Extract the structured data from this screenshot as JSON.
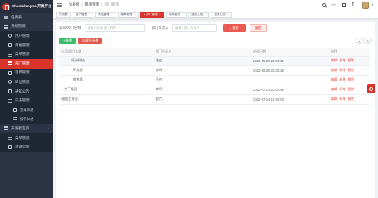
{
  "brand": {
    "name": "Chomolungma 开发平台",
    "accent": "#d9342b"
  },
  "sidebar": {
    "items": [
      {
        "label": "任务表",
        "level": 0,
        "icon": "ln",
        "name": "sidebar-item-task-table"
      },
      {
        "label": "系统管理",
        "level": 0,
        "icon": "gr",
        "name": "sidebar-item-system",
        "chev": "^"
      },
      {
        "label": "用户管理",
        "level": 1,
        "icon": "ci",
        "name": "sidebar-item-users"
      },
      {
        "label": "角色管理",
        "level": 1,
        "icon": "sq",
        "name": "sidebar-item-roles"
      },
      {
        "label": "菜单管理",
        "level": 1,
        "icon": "ln",
        "name": "sidebar-item-menus"
      },
      {
        "label": "部门管理",
        "level": 1,
        "icon": "gr",
        "name": "sidebar-item-depts",
        "active": true
      },
      {
        "label": "字典管理",
        "level": 1,
        "icon": "sq",
        "name": "sidebar-item-dict"
      },
      {
        "label": "岗位管理",
        "level": 1,
        "icon": "ci",
        "name": "sidebar-item-posts"
      },
      {
        "label": "通知公告",
        "level": 1,
        "icon": "sq",
        "name": "sidebar-item-notice"
      },
      {
        "label": "日志管理",
        "level": 1,
        "icon": "ln",
        "name": "sidebar-item-logs",
        "chev": "^"
      },
      {
        "label": "登录日志",
        "level": 2,
        "icon": "sq",
        "name": "sidebar-item-login-log"
      },
      {
        "label": "操作日志",
        "level": 2,
        "icon": "ln",
        "name": "sidebar-item-oper-log"
      },
      {
        "label": "开发者选项",
        "level": 0,
        "icon": "gr",
        "name": "sidebar-item-dev",
        "chev": "^"
      },
      {
        "label": "菜单管理",
        "level": 1,
        "icon": "ln",
        "name": "sidebar-item-dev-menus"
      },
      {
        "label": "测试页面",
        "level": 1,
        "icon": "sq",
        "name": "sidebar-item-test-page"
      }
    ]
  },
  "header": {
    "breadcrumb": [
      "仪表盘",
      "系统管理",
      "部门管理"
    ]
  },
  "tags": [
    {
      "label": "任务表"
    },
    {
      "label": "用户管理"
    },
    {
      "label": "角色管理"
    },
    {
      "label": "菜单管理"
    },
    {
      "label": "部门管理",
      "active": true
    },
    {
      "label": "字典管理"
    },
    {
      "label": "通知公告"
    },
    {
      "label": "登录日志"
    }
  ],
  "query": {
    "name_label": "公司/部门名称",
    "name_placeholder": "请输入公司/部门名称",
    "leader_label": "部门负责人",
    "leader_placeholder": "请输入部门负责人",
    "search_label": "搜索",
    "reset_label": "重置"
  },
  "actions": {
    "add_label": "+ 新增",
    "expand_label": "⇅ 展开/折叠"
  },
  "table": {
    "columns": [
      "公司/部门名称",
      "部门负责人",
      "创建日期",
      "操作"
    ],
    "rows": [
      {
        "name": "阿诚科技",
        "leader": "张三",
        "date": "2022-05-25 22:30:01",
        "indent": 1,
        "expander": "⌄",
        "hl": true
      },
      {
        "name": "开发部",
        "leader": "李四",
        "date": "2022-05-25 22:35:26",
        "indent": 2
      },
      {
        "name": "销售部",
        "leader": "王五",
        "date": "",
        "indent": 2
      },
      {
        "name": "大干集团",
        "leader": "李四",
        "date": "2022-07-13 22:00:48",
        "indent": 0,
        "expander": "›"
      },
      {
        "name": "雅居工作室",
        "leader": "赵六",
        "date": "2022-07-14 15:30:06",
        "indent": 0
      }
    ],
    "ops": [
      "编辑",
      "新增",
      "删除"
    ]
  }
}
